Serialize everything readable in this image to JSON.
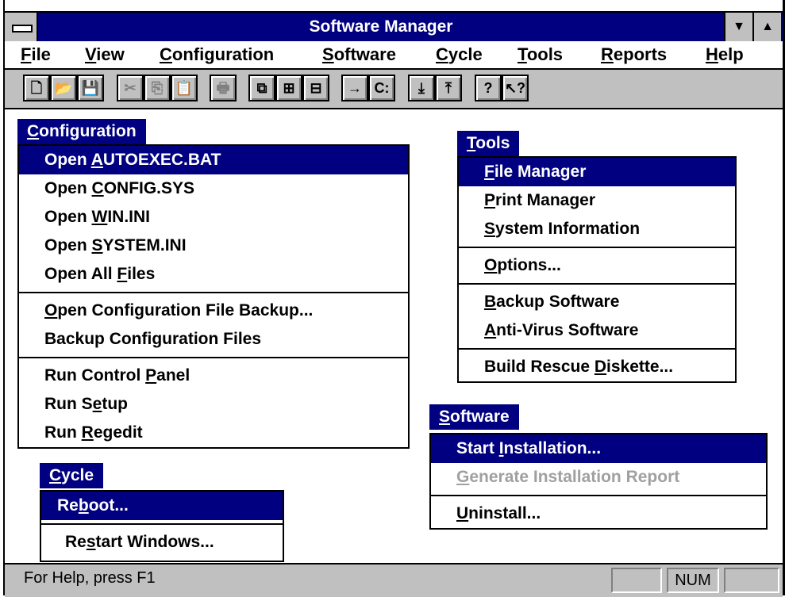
{
  "window": {
    "title": "Software Manager",
    "minimize_glyph": "▼",
    "maximize_glyph": "▲"
  },
  "menubar": [
    {
      "pre": "",
      "u": "F",
      "post": "ile"
    },
    {
      "pre": "",
      "u": "V",
      "post": "iew"
    },
    {
      "pre": "",
      "u": "C",
      "post": "onfiguration"
    },
    {
      "pre": "",
      "u": "S",
      "post": "oftware"
    },
    {
      "pre": "",
      "u": "C",
      "post": "ycle"
    },
    {
      "pre": "",
      "u": "T",
      "post": "ools"
    },
    {
      "pre": "",
      "u": "R",
      "post": "eports"
    },
    {
      "pre": "",
      "u": "H",
      "post": "elp"
    }
  ],
  "toolbar": {
    "icons": [
      "new-file-icon",
      "open-folder-icon",
      "save-icon",
      "cut-icon",
      "copy-icon",
      "paste-icon",
      "print-icon",
      "cascade-icon",
      "tile-icon",
      "arrange-icon",
      "run-icon",
      "drive-icon",
      "install-icon",
      "uninstall-icon",
      "help-icon",
      "context-help-icon"
    ],
    "glyphs": [
      "🗋",
      "📂",
      "💾",
      "✂",
      "⎘",
      "📋",
      "🖶",
      "⧉",
      "⊞",
      "⊟",
      "→",
      "C:",
      "⤓",
      "⤒",
      "?",
      "↖?"
    ]
  },
  "configuration_menu": {
    "title": {
      "pre": "",
      "u": "C",
      "post": "onfiguration"
    },
    "items": [
      {
        "pre": "Open ",
        "u": "A",
        "post": "UTOEXEC.BAT"
      },
      {
        "pre": "Open ",
        "u": "C",
        "post": "ONFIG.SYS"
      },
      {
        "pre": "Open ",
        "u": "W",
        "post": "IN.INI"
      },
      {
        "pre": "Open ",
        "u": "S",
        "post": "YSTEM.INI"
      },
      {
        "pre": "Open All ",
        "u": "F",
        "post": "iles"
      },
      {
        "pre": "",
        "u": "O",
        "post": "pen Configuration File Backup..."
      },
      {
        "pre": "Backup Configuration Files",
        "u": "",
        "post": ""
      },
      {
        "pre": "Run Control ",
        "u": "P",
        "post": "anel"
      },
      {
        "pre": "Run S",
        "u": "e",
        "post": "tup"
      },
      {
        "pre": "Run ",
        "u": "R",
        "post": "egedit"
      }
    ]
  },
  "tools_menu": {
    "title": {
      "pre": "",
      "u": "T",
      "post": "ools"
    },
    "items": [
      {
        "pre": "",
        "u": "F",
        "post": "ile Manager"
      },
      {
        "pre": "",
        "u": "P",
        "post": "rint Manager"
      },
      {
        "pre": "",
        "u": "S",
        "post": "ystem Information"
      },
      {
        "pre": "",
        "u": "O",
        "post": "ptions..."
      },
      {
        "pre": "",
        "u": "B",
        "post": "ackup Software"
      },
      {
        "pre": "",
        "u": "A",
        "post": "nti-Virus Software"
      },
      {
        "pre": "Build Rescue ",
        "u": "D",
        "post": "iskette..."
      }
    ]
  },
  "software_menu": {
    "title": {
      "pre": "",
      "u": "S",
      "post": "oftware"
    },
    "items": [
      {
        "pre": "Start ",
        "u": "I",
        "post": "nstallation..."
      },
      {
        "pre": "",
        "u": "G",
        "post": "enerate Installation Report"
      },
      {
        "pre": "",
        "u": "U",
        "post": "ninstall..."
      }
    ]
  },
  "cycle_menu": {
    "title": {
      "pre": "",
      "u": "C",
      "post": "ycle"
    },
    "items": [
      {
        "pre": "Re",
        "u": "b",
        "post": "oot..."
      },
      {
        "pre": "Re",
        "u": "s",
        "post": "tart Windows..."
      }
    ]
  },
  "statusbar": {
    "help_text": "For Help, press F1",
    "num_indicator": "NUM"
  },
  "colors": {
    "title_bar": "#000080",
    "selection": "#000080",
    "face": "#c0c0c0",
    "disabled_text": "#a0a0a0"
  }
}
